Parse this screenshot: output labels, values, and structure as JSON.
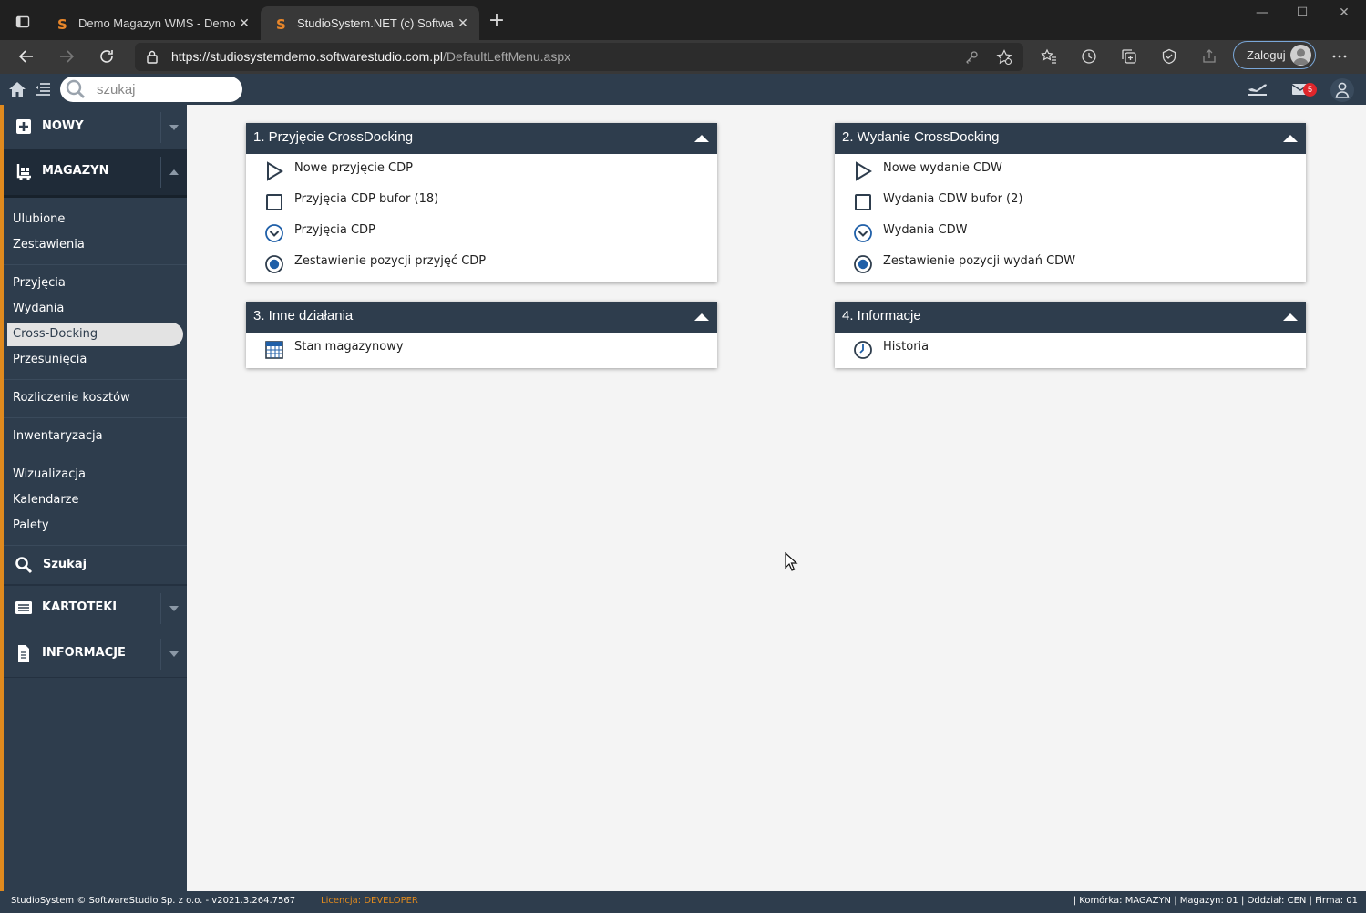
{
  "browser": {
    "tabs": [
      {
        "title": "Demo Magazyn WMS - Demo online",
        "active": false
      },
      {
        "title": "StudioSystem.NET (c) SoftwareStudio",
        "active": true
      }
    ],
    "url_base": "https://studiosystemdemo.softwarestudio.com.pl",
    "url_path": "/DefaultLeftMenu.aspx",
    "login_label": "Zaloguj"
  },
  "header": {
    "search_placeholder": "szukaj",
    "mail_count": "5"
  },
  "sidebar": {
    "groups": {
      "nowy": "NOWY",
      "magazyn": "MAGAZYN",
      "szukaj": "Szukaj",
      "kartoteki": "KARTOTEKI",
      "informacje": "INFORMACJE"
    },
    "items": {
      "ulubione": "Ulubione",
      "zestawienia": "Zestawienia",
      "przyjecia": "Przyjęcia",
      "wydania": "Wydania",
      "crossdocking": "Cross-Docking",
      "przesuniecia": "Przesunięcia",
      "rozliczenie": "Rozliczenie kosztów",
      "inwentaryzacja": "Inwentaryzacja",
      "wizualizacja": "Wizualizacja",
      "kalendarze": "Kalendarze",
      "palety": "Palety"
    }
  },
  "panels": {
    "p1": {
      "title": "1. Przyjęcie CrossDocking",
      "items": [
        "Nowe przyjęcie CDP",
        "Przyjęcia CDP bufor (18)",
        "Przyjęcia CDP",
        "Zestawienie pozycji przyjęć CDP"
      ]
    },
    "p2": {
      "title": "2. Wydanie CrossDocking",
      "items": [
        "Nowe wydanie CDW",
        "Wydania CDW bufor (2)",
        "Wydania CDW",
        "Zestawienie pozycji wydań CDW"
      ]
    },
    "p3": {
      "title": "3. Inne działania",
      "items": [
        "Stan magazynowy"
      ]
    },
    "p4": {
      "title": "4. Informacje",
      "items": [
        "Historia"
      ]
    }
  },
  "footer": {
    "copyright": "StudioSystem © SoftwareStudio Sp. z o.o. - v2021.3.264.7567",
    "license_label": "Licencja:",
    "license_value": "DEVELOPER",
    "context": "| Komórka: MAGAZYN | Magazyn: 01 | Oddział: CEN | Firma: 01"
  },
  "colors": {
    "brand_dark": "#2e3d4d",
    "accent_orange": "#e08a1e",
    "icon_blue": "#1f5fa8"
  }
}
